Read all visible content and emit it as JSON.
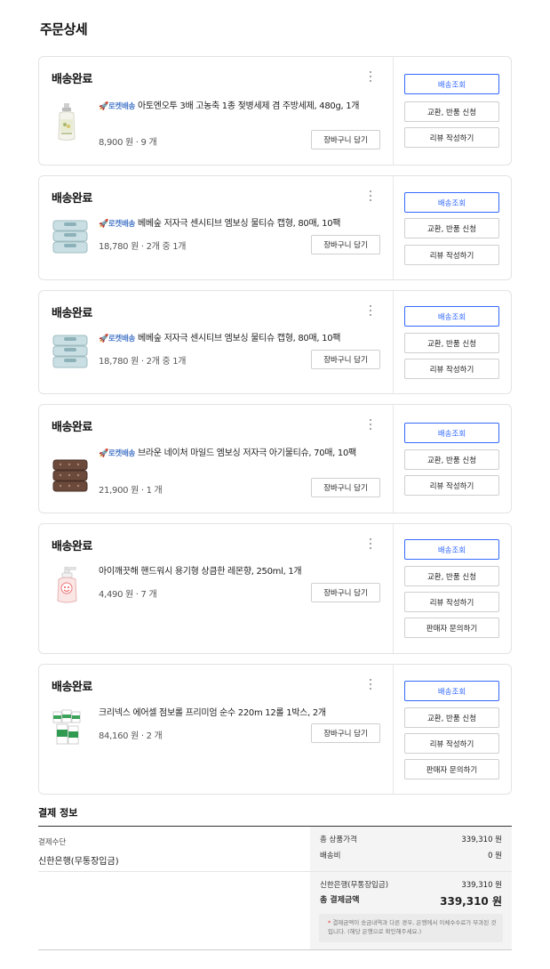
{
  "page_title": "주문상세",
  "cart_label": "장바구니 담기",
  "rocket_label": "로켓배송",
  "rocket_icon": "rocket-icon",
  "orders": [
    {
      "status": "배송완료",
      "rocket": true,
      "name": "아토엔오투 3배 고농축 1종 젖병세제 겸 주방세제, 480g, 1개",
      "price": "8,900 원 · 9 개",
      "buttons": [
        "배송조회",
        "교환, 반품 신청",
        "리뷰 작성하기"
      ]
    },
    {
      "status": "배송완료",
      "rocket": true,
      "name": "베베숲 저자극 센시티브 엠보싱 물티슈 캡형, 80매, 10팩",
      "price": "18,780 원 · 2개 중 1개",
      "buttons": [
        "배송조회",
        "교환, 반품 신청",
        "리뷰 작성하기"
      ]
    },
    {
      "status": "배송완료",
      "rocket": true,
      "name": "베베숲 저자극 센시티브 엠보싱 물티슈 캡형, 80매, 10팩",
      "price": "18,780 원 · 2개 중 1개",
      "buttons": [
        "배송조회",
        "교환, 반품 신청",
        "리뷰 작성하기"
      ]
    },
    {
      "status": "배송완료",
      "rocket": true,
      "name": "브라운 네이처 마일드 엠보싱 저자극 아기물티슈, 70매, 10팩",
      "price": "21,900 원 · 1 개",
      "buttons": [
        "배송조회",
        "교환, 반품 신청",
        "리뷰 작성하기"
      ]
    },
    {
      "status": "배송완료",
      "rocket": false,
      "name": "아이깨끗해 핸드워시 용기형 상큼한 레몬향, 250ml, 1개",
      "price": "4,490 원 · 7 개",
      "buttons": [
        "배송조회",
        "교환, 반품 신청",
        "리뷰 작성하기",
        "판매자 문의하기"
      ]
    },
    {
      "status": "배송완료",
      "rocket": false,
      "name": "크리넥스 에어셀 점보롤 프리미엄 순수 220m 12롤 1박스, 2개",
      "price": "84,160 원 · 2 개",
      "buttons": [
        "배송조회",
        "교환, 반품 신청",
        "리뷰 작성하기",
        "판매자 문의하기"
      ]
    }
  ],
  "payment": {
    "title": "결제 정보",
    "method_label": "결제수단",
    "method": "신한은행(무통장입금)",
    "product_total_label": "총 상품가격",
    "product_total": "339,310 원",
    "shipping_label": "배송비",
    "shipping": "0 원",
    "bank_label": "신한은행(무통장입금)",
    "bank_amount": "339,310 원",
    "total_label": "총 결제금액",
    "total": "339,310 원",
    "notice": "결제금액이 송금내역과 다른 경우, 은행에서 이체수수료가 부과된 것 입니다. (해당 은행으로 확인해주세요.)"
  },
  "colors": {
    "primary": "#346aff",
    "rocket": "#4a79c9"
  }
}
